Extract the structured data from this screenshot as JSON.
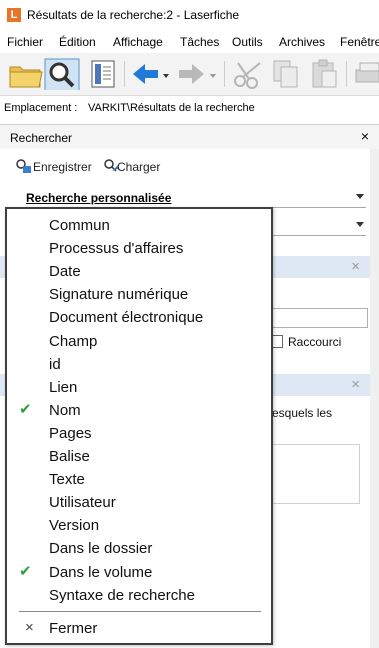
{
  "window": {
    "title": "Résultats de la recherche:2 - Laserfiche",
    "logo_letter": "L"
  },
  "menu": [
    "Fichier",
    "Édition",
    "Affichage",
    "Tâches",
    "Outils",
    "Archives",
    "Fenêtre"
  ],
  "location": {
    "label": "Emplacement :",
    "path": "VARKIT\\Résultats de la recherche"
  },
  "panel": {
    "title": "Rechercher",
    "close_glyph": "×",
    "save_label": "Enregistrer",
    "load_label": "Charger",
    "search_type": "Recherche personnalisée"
  },
  "background": {
    "shortcut_label": "Raccourci",
    "partial_text": "esquels les",
    "bluebar_close": "×"
  },
  "popup": {
    "items": [
      {
        "label": "Commun",
        "checked": false
      },
      {
        "label": "Processus d'affaires",
        "checked": false
      },
      {
        "label": "Date",
        "checked": false
      },
      {
        "label": "Signature numérique",
        "checked": false
      },
      {
        "label": "Document électronique",
        "checked": false
      },
      {
        "label": "Champ",
        "checked": false
      },
      {
        "label": "id",
        "checked": false
      },
      {
        "label": "Lien",
        "checked": false
      },
      {
        "label": "Nom",
        "checked": true
      },
      {
        "label": "Pages",
        "checked": false
      },
      {
        "label": "Balise",
        "checked": false
      },
      {
        "label": "Texte",
        "checked": false
      },
      {
        "label": "Utilisateur",
        "checked": false
      },
      {
        "label": "Version",
        "checked": false
      },
      {
        "label": "Dans le dossier",
        "checked": false
      },
      {
        "label": "Dans le volume",
        "checked": true
      },
      {
        "label": "Syntaxe de recherche",
        "checked": false
      }
    ],
    "close_label": "Fermer",
    "close_glyph": "×",
    "check_glyph": "✔"
  },
  "colors": {
    "accent_orange": "#e8742a",
    "check_green": "#2e9e3e",
    "bluebar": "#dde8f4",
    "nav_blue": "#1f7bd6"
  }
}
